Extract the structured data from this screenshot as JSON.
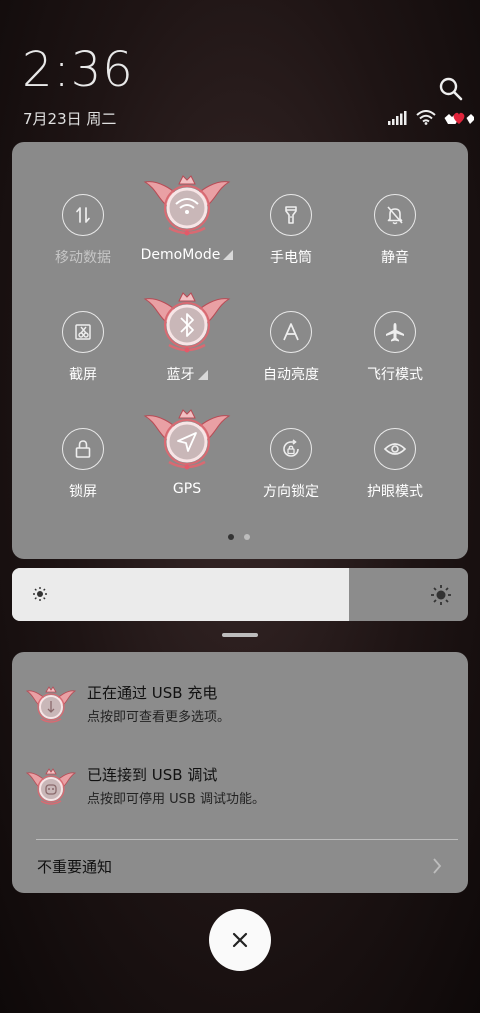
{
  "lockscreen": {
    "time": "2:36",
    "date": "7月23日 周二"
  },
  "status_bar": {
    "icons": [
      "signal-icon",
      "wifi-icon",
      "battery-hearts-icon"
    ]
  },
  "quick_settings": {
    "tiles": [
      {
        "label": "移动数据",
        "icon": "mobile-data-icon",
        "active": false,
        "dimmed": true
      },
      {
        "label": "DemoMode",
        "icon": "wifi-icon",
        "active": true,
        "expandable": true
      },
      {
        "label": "手电筒",
        "icon": "flashlight-icon",
        "active": false
      },
      {
        "label": "静音",
        "icon": "mute-bell-icon",
        "active": false
      },
      {
        "label": "截屏",
        "icon": "screenshot-icon",
        "active": false
      },
      {
        "label": "蓝牙",
        "icon": "bluetooth-icon",
        "active": true,
        "expandable": true
      },
      {
        "label": "自动亮度",
        "icon": "auto-brightness-icon",
        "active": false
      },
      {
        "label": "飞行模式",
        "icon": "airplane-icon",
        "active": false
      },
      {
        "label": "锁屏",
        "icon": "lock-icon",
        "active": false
      },
      {
        "label": "GPS",
        "icon": "location-icon",
        "active": true
      },
      {
        "label": "方向锁定",
        "icon": "rotation-lock-icon",
        "active": false
      },
      {
        "label": "护眼模式",
        "icon": "eye-icon",
        "active": false
      }
    ],
    "page_count": 2,
    "current_page": 1
  },
  "brightness": {
    "level": 0.74
  },
  "notifications": {
    "items": [
      {
        "title": "正在通过 USB 充电",
        "text": "点按即可查看更多选项。"
      },
      {
        "title": "已连接到 USB 调试",
        "text": "点按即可停用 USB 调试功能。"
      }
    ],
    "footer_label": "不重要通知"
  },
  "colors": {
    "panel": "#8a8a8a",
    "accent": "#e0646a"
  }
}
